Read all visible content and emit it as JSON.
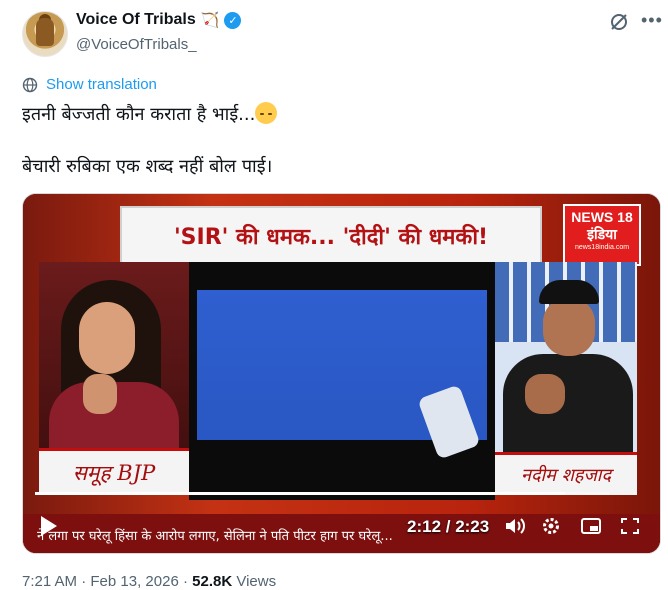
{
  "author": {
    "display_name": "Voice Of Tribals",
    "handle": "@VoiceOfTribals_",
    "name_emoji_icon": "bow-and-arrow-icon",
    "verified_icon": "verified-badge-icon"
  },
  "actions": {
    "grok_icon": "grok-icon",
    "more_icon": "more-options-icon"
  },
  "translate": {
    "label": "Show translation",
    "icon": "globe-icon"
  },
  "tweet": {
    "line1": "इतनी बेज्जती कौन कराता है भाई...",
    "line1_emoji": "pensive-face-emoji",
    "line2": "बेचारी रुबिका एक शब्द नहीं बोल पाई।"
  },
  "video": {
    "headline": "'SIR' की धमक... 'दीदी' की धमकी!",
    "channel_logo": {
      "line1": "NEWS 18",
      "line2": "इंडिया",
      "line3": "news18india.com"
    },
    "caption_left": "समूह BJP",
    "caption_right": "नदीम शहजाद",
    "ticker": "ने लगा पर घरेलू हिंसा के आरोप लगाए, सेलिना ने पति पीटर हाग पर घरेलू...",
    "time": "2:12 / 2:23",
    "progress_fraction": 0.923,
    "controls": [
      "play-icon",
      "volume-icon",
      "settings-icon",
      "picture-in-picture-icon",
      "fullscreen-icon"
    ]
  },
  "meta": {
    "time": "7:21 AM",
    "date": "Feb 13, 2026",
    "views_count": "52.8K",
    "views_label": "Views"
  },
  "colors": {
    "link": "#1d9bf0",
    "text": "#0f1419",
    "secondary": "#536471"
  }
}
